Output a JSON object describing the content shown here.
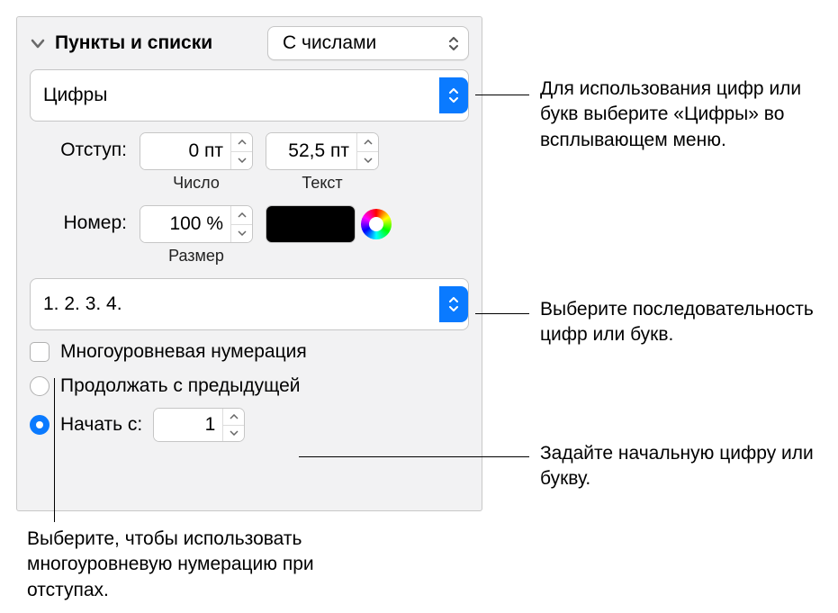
{
  "header": {
    "title": "Пункты и списки",
    "style_dropdown": "С числами"
  },
  "type_dropdown": "Цифры",
  "indent": {
    "label": "Отступ:",
    "number_value": "0 пт",
    "number_sublabel": "Число",
    "text_value": "52,5 пт",
    "text_sublabel": "Текст"
  },
  "number": {
    "label": "Номер:",
    "size_value": "100 %",
    "size_sublabel": "Размер"
  },
  "format_dropdown": "1. 2. 3. 4.",
  "tiered_checkbox": "Многоуровневая нумерация",
  "continue_radio": "Продолжать с предыдущей",
  "start_radio": "Начать с:",
  "start_value": "1",
  "callouts": {
    "type": "Для использования цифр или букв выберите «Цифры» во всплывающем меню.",
    "format": "Выберите последовательность цифр или букв.",
    "start": "Задайте начальную цифру или букву.",
    "tiered": "Выберите, чтобы использовать многоуровневую нумерацию при отступах."
  }
}
